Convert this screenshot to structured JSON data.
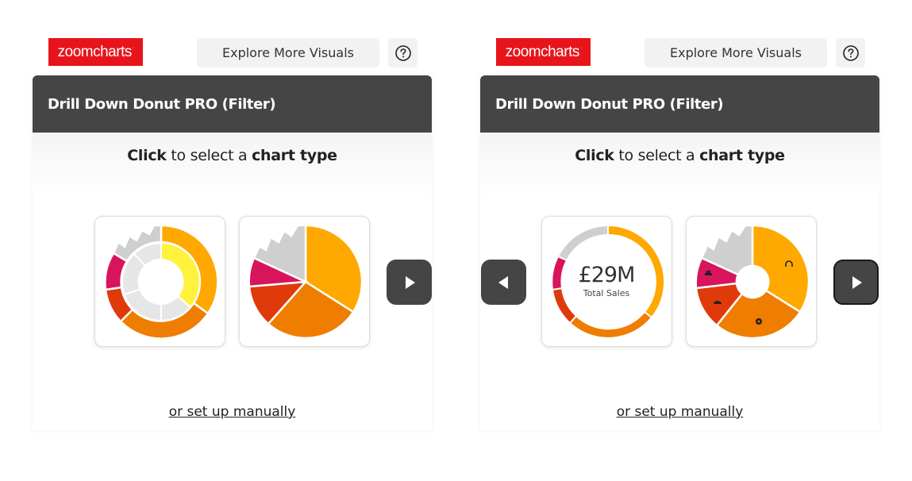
{
  "brand": {
    "name": "zoomcharts",
    "mark": "·",
    "color": "#e8141c"
  },
  "colors": {
    "header": "#454545",
    "orange_light": "#ffa800",
    "orange": "#ef7d00",
    "red": "#e03a0b",
    "magenta": "#d8145c",
    "yellow": "#fff23c",
    "grey": "#cfcfcf"
  },
  "panels": [
    {
      "explore_label": "Explore More Visuals",
      "help_icon": "question-circle-icon",
      "title": "Drill Down Donut PRO (Filter)",
      "prompt": {
        "strong1": "Click",
        "middle": " to select a ",
        "strong2": "chart type"
      },
      "tiles": [
        {
          "type": "multi-level-donut",
          "icon": "multi-level-donut-icon"
        },
        {
          "type": "pie",
          "icon": "pie-chart-icon"
        }
      ],
      "nav": {
        "next": "next-arrow-icon"
      },
      "setup_link": "or set up manually"
    },
    {
      "explore_label": "Explore More Visuals",
      "help_icon": "question-circle-icon",
      "title": "Drill Down Donut PRO (Filter)",
      "prompt": {
        "strong1": "Click",
        "middle": " to select a ",
        "strong2": "chart type"
      },
      "tiles": [
        {
          "type": "donut-kpi",
          "icon": "donut-kpi-icon",
          "kpi_value": "£29M",
          "kpi_label": "Total Sales"
        },
        {
          "type": "donut-with-icons",
          "icon": "donut-with-icons-icon"
        }
      ],
      "nav": {
        "prev": "previous-arrow-icon",
        "next": "next-arrow-icon"
      },
      "setup_link": "or set up manually"
    }
  ]
}
